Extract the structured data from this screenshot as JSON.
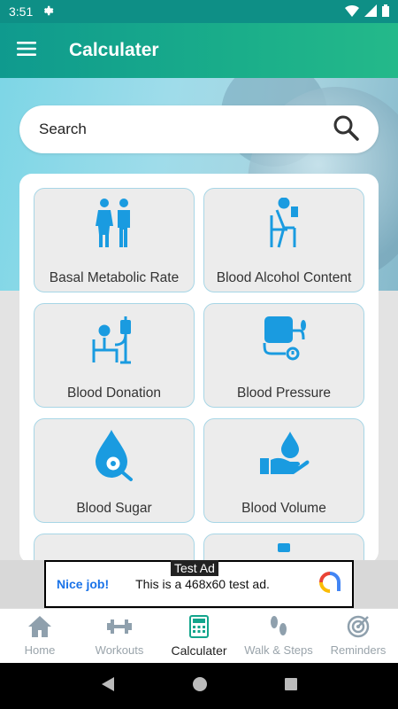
{
  "status_bar": {
    "time": "3:51"
  },
  "app_bar": {
    "title": "Calculater"
  },
  "search": {
    "placeholder": "Search"
  },
  "calculators": [
    {
      "label": "Basal Metabolic Rate",
      "icon": "people-icon"
    },
    {
      "label": "Blood Alcohol Content",
      "icon": "drinking-person-icon"
    },
    {
      "label": "Blood Donation",
      "icon": "blood-donation-icon"
    },
    {
      "label": "Blood Pressure",
      "icon": "blood-pressure-icon"
    },
    {
      "label": "Blood Sugar",
      "icon": "blood-sugar-drop-icon"
    },
    {
      "label": "Blood Volume",
      "icon": "hand-drop-icon"
    }
  ],
  "ad": {
    "tag": "Test Ad",
    "nice": "Nice job!",
    "text": "This is a 468x60 test ad."
  },
  "bottom_nav": [
    {
      "label": "Home",
      "icon": "home-icon"
    },
    {
      "label": "Workouts",
      "icon": "dumbbell-icon"
    },
    {
      "label": "Calculater",
      "icon": "calculator-icon",
      "active": true
    },
    {
      "label": "Walk & Steps",
      "icon": "footsteps-icon"
    },
    {
      "label": "Reminders",
      "icon": "target-icon"
    }
  ],
  "colors": {
    "accent": "#1a9be0",
    "app_bar": "#16a58c",
    "tile_border": "#a7d6e6"
  }
}
